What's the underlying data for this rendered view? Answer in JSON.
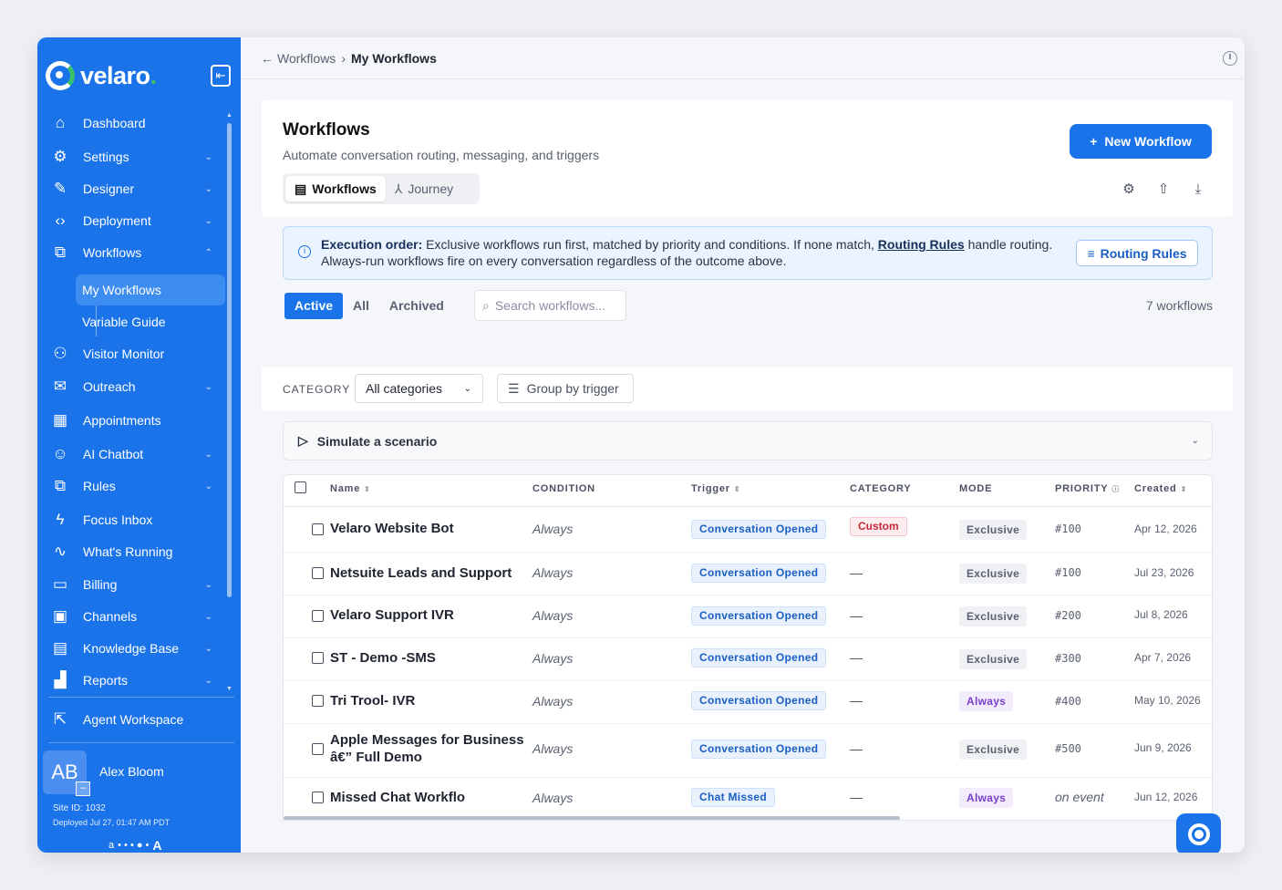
{
  "brand": {
    "name": "velaro",
    "dot": ".",
    "color": "#1a73e8",
    "accent": "#39c26b"
  },
  "sidebar": {
    "collapse_icon": "collapse-panel-icon",
    "items": [
      {
        "label": "Dashboard",
        "icon": "home-icon",
        "glyph": "⌂",
        "chevron": ""
      },
      {
        "label": "Settings",
        "icon": "settings-panel-icon",
        "glyph": "⚙",
        "chevron": "⌄"
      },
      {
        "label": "Designer",
        "icon": "designer-icon",
        "glyph": "✎",
        "chevron": "⌄"
      },
      {
        "label": "Deployment",
        "icon": "code-icon",
        "glyph": "‹›",
        "chevron": "⌄"
      },
      {
        "label": "Workflows",
        "icon": "workflow-icon",
        "glyph": "⧉",
        "chevron": "⌃"
      }
    ],
    "subitems": [
      {
        "label": "My Workflows",
        "active": true
      },
      {
        "label": "Variable Guide",
        "active": false
      }
    ],
    "items2": [
      {
        "label": "Visitor Monitor",
        "icon": "users-icon",
        "glyph": "⚇",
        "chevron": ""
      },
      {
        "label": "Outreach",
        "icon": "mail-icon",
        "glyph": "✉",
        "chevron": "⌄"
      },
      {
        "label": "Appointments",
        "icon": "calendar-icon",
        "glyph": "▦",
        "chevron": ""
      },
      {
        "label": "AI Chatbot",
        "icon": "robot-icon",
        "glyph": "☺",
        "chevron": "⌄"
      },
      {
        "label": "Rules",
        "icon": "rules-icon",
        "glyph": "⧉",
        "chevron": "⌄"
      },
      {
        "label": "Focus Inbox",
        "icon": "bolt-icon",
        "glyph": "ϟ",
        "chevron": ""
      },
      {
        "label": "What's Running",
        "icon": "pulse-icon",
        "glyph": "∿",
        "chevron": ""
      },
      {
        "label": "Billing",
        "icon": "card-icon",
        "glyph": "▭",
        "chevron": "⌄"
      },
      {
        "label": "Channels",
        "icon": "chat-icon",
        "glyph": "▣",
        "chevron": "⌄"
      },
      {
        "label": "Knowledge Base",
        "icon": "book-icon",
        "glyph": "▤",
        "chevron": "⌄"
      },
      {
        "label": "Reports",
        "icon": "bar-chart-icon",
        "glyph": "▟",
        "chevron": "⌄"
      }
    ],
    "agent_workspace": {
      "label": "Agent Workspace",
      "glyph": "⇱"
    },
    "user": {
      "initials": "AB",
      "mini": "–",
      "name": "Alex Bloom",
      "site_id": "Site ID: 1032",
      "deployed": "Deployed Jul 27, 01:47 AM PDT"
    },
    "font_small": "a",
    "font_dots": "• • • ● •",
    "font_large": "A"
  },
  "topbar": {
    "back_arrow": "←",
    "crumb_parent": "Workflows",
    "crumb_sep": "›",
    "crumb_current": "My Workflows"
  },
  "header": {
    "title": "Workflows",
    "subtitle": "Automate conversation routing, messaging, and triggers",
    "tabs": [
      {
        "label": "Workflows",
        "glyph": "▤",
        "active": true
      },
      {
        "label": "Journey",
        "glyph": "⅄",
        "active": false
      }
    ],
    "new_button": {
      "plus": "+",
      "label": "New Workflow"
    },
    "icons": [
      {
        "name": "gear-icon",
        "glyph": "⚙"
      },
      {
        "name": "upload-icon",
        "glyph": "⇧"
      },
      {
        "name": "download-icon",
        "glyph": "⤓"
      }
    ]
  },
  "banner": {
    "info_glyph": "i",
    "bold": "Execution order:",
    "text1": " Exclusive workflows run first, matched by priority and conditions. If none match, ",
    "link": "Routing Rules",
    "text2": " handle routing. Always-run workflows fire on every conversation regardless of the outcome above.",
    "button_glyph": "≡",
    "button": "Routing Rules"
  },
  "filters": {
    "segments": [
      {
        "label": "Active",
        "active": true
      },
      {
        "label": "All",
        "active": false
      },
      {
        "label": "Archived",
        "active": false
      }
    ],
    "search_placeholder": "Search workflows...",
    "count": "7 workflows"
  },
  "category_bar": {
    "label": "CATEGORY",
    "select": "All categories",
    "group_glyph": "☰",
    "group": "Group by trigger"
  },
  "simulate": {
    "glyph": "▷",
    "label": "Simulate a scenario"
  },
  "table": {
    "headers": {
      "name": "Name",
      "condition": "CONDITION",
      "trigger": "Trigger",
      "category": "CATEGORY",
      "mode": "MODE",
      "priority": "PRIORITY",
      "created": "Created",
      "sort_glyph": "⇕",
      "info_glyph": "ⓘ"
    },
    "rows": [
      {
        "name": "Velaro Website Bot",
        "condition": "Always",
        "trigger": "Conversation Opened",
        "category": "Custom",
        "mode": "Exclusive",
        "priority": "#100",
        "created": "Apr 12, 2026"
      },
      {
        "name": "Netsuite Leads and Support",
        "condition": "Always",
        "trigger": "Conversation Opened",
        "category": "—",
        "mode": "Exclusive",
        "priority": "#100",
        "created": "Jul 23, 2026"
      },
      {
        "name": "Velaro Support IVR",
        "condition": "Always",
        "trigger": "Conversation Opened",
        "category": "—",
        "mode": "Exclusive",
        "priority": "#200",
        "created": "Jul 8, 2026"
      },
      {
        "name": "ST - Demo -SMS",
        "condition": "Always",
        "trigger": "Conversation Opened",
        "category": "—",
        "mode": "Exclusive",
        "priority": "#300",
        "created": "Apr 7, 2026"
      },
      {
        "name": "Tri Trool- IVR",
        "condition": "Always",
        "trigger": "Conversation Opened",
        "category": "—",
        "mode": "Always",
        "priority": "#400",
        "created": "May 10, 2026"
      },
      {
        "name": "Apple Messages for Business â€” Full Demo",
        "condition": "Always",
        "trigger": "Conversation Opened",
        "category": "—",
        "mode": "Exclusive",
        "priority": "#500",
        "created": "Jun 9, 2026"
      },
      {
        "name": "Missed Chat Workflo",
        "condition": "Always",
        "trigger": "Chat Missed",
        "category": "—",
        "mode": "Always",
        "priority": "on event",
        "created": "Jun 12, 2026"
      }
    ]
  }
}
